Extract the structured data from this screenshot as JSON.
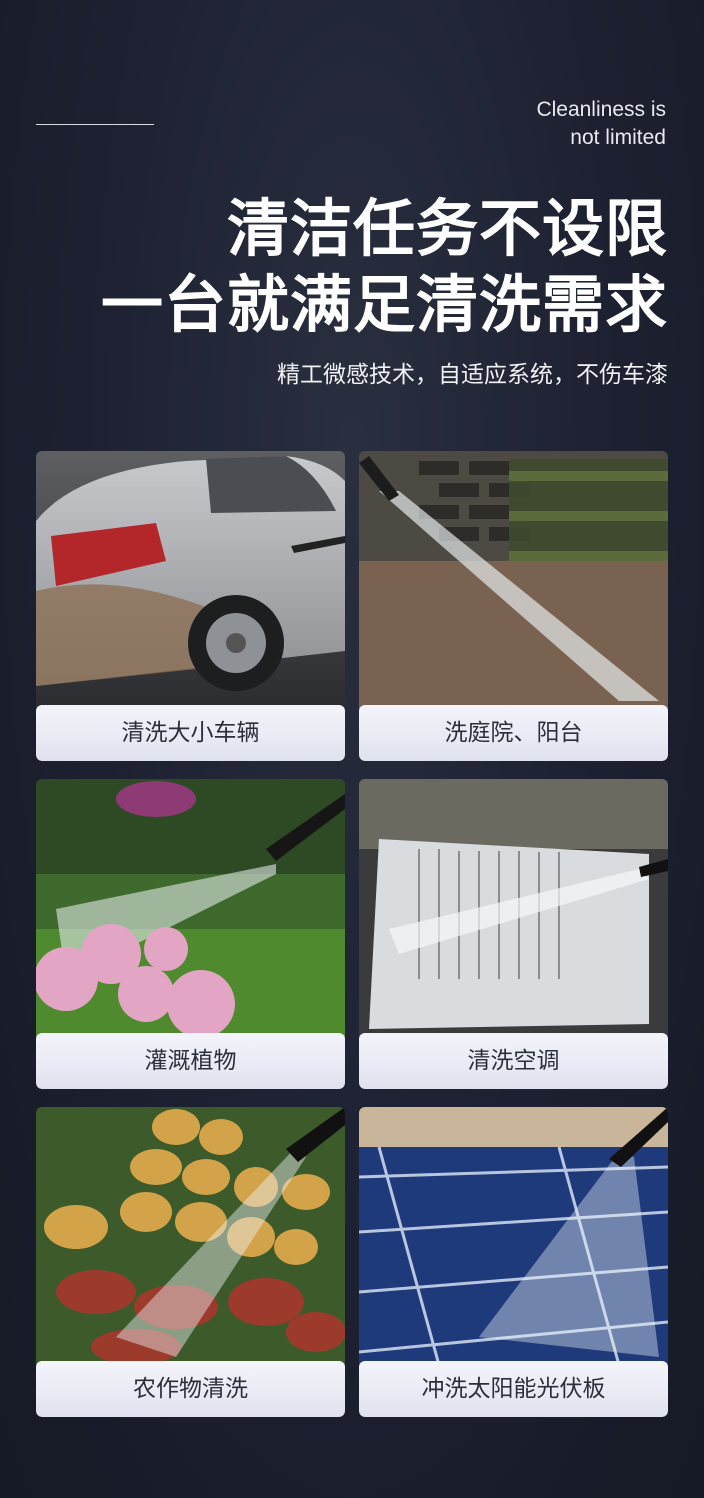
{
  "tagline": [
    "Cleanliness is",
    "not limited"
  ],
  "headline": [
    "清洁任务不设限",
    "一台就满足清洗需求"
  ],
  "subheadline": "精工微感技术，自适应系统，不伤车漆",
  "cards": [
    {
      "label": "清洗大小车辆",
      "icon": "car-wash-photo"
    },
    {
      "label": "洗庭院、阳台",
      "icon": "courtyard-wash-photo"
    },
    {
      "label": "灌溉植物",
      "icon": "plant-watering-photo"
    },
    {
      "label": "清洗空调",
      "icon": "air-conditioner-wash-photo"
    },
    {
      "label": "农作物清洗",
      "icon": "crop-wash-photo"
    },
    {
      "label": "冲洗太阳能光伏板",
      "icon": "solar-panel-wash-photo"
    }
  ]
}
